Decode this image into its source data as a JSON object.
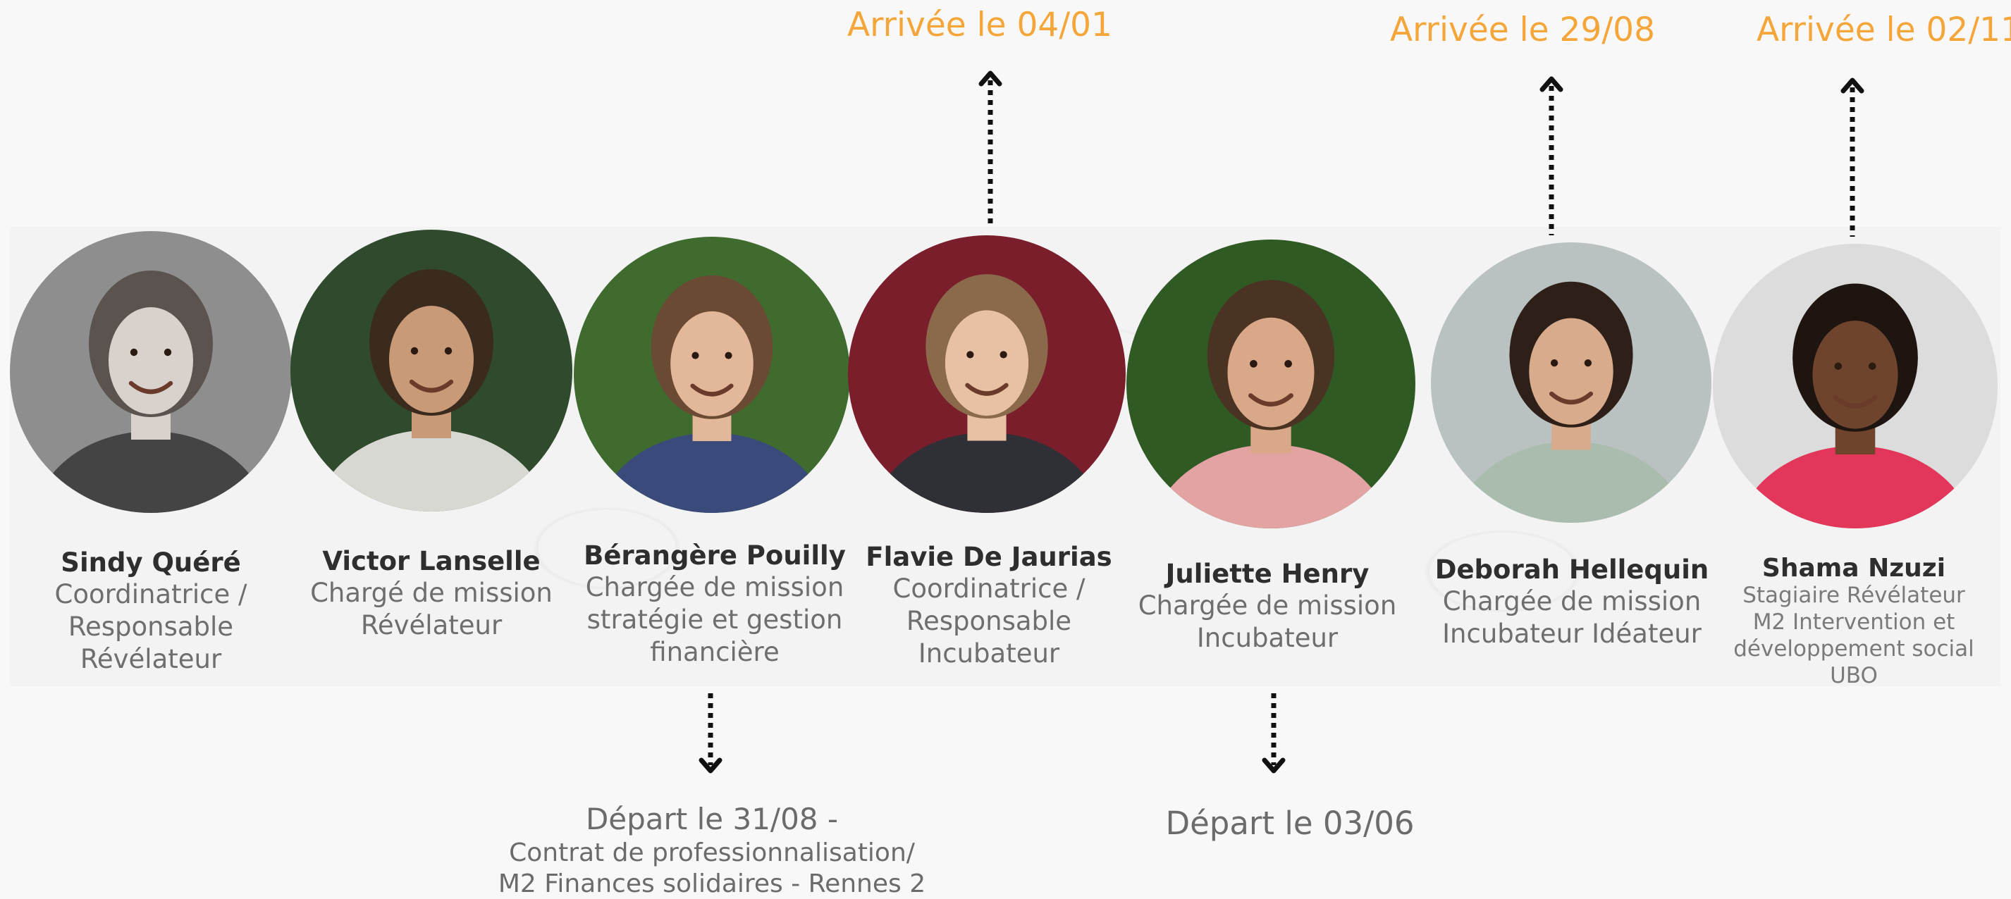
{
  "team": [
    {
      "name": "Sindy Quéré",
      "role": [
        "Coordinatrice /",
        "Responsable",
        "Révélateur"
      ],
      "photo_bg": "#8e8e8e",
      "tone": "#d9d2cc",
      "hair": "#5a5350",
      "shirt": "#444444"
    },
    {
      "name": "Victor Lanselle",
      "role": [
        "Chargé de mission",
        "Révélateur"
      ],
      "photo_bg": "#2f4a2c",
      "tone": "#c99a78",
      "hair": "#3b2a1e",
      "shirt": "#d8d8d2"
    },
    {
      "name": "Bérangère Pouilly",
      "role": [
        "Chargée de mission",
        "stratégie et gestion",
        "financière"
      ],
      "photo_bg": "#3f6b2e",
      "tone": "#e2b79a",
      "hair": "#6a4a33",
      "shirt": "#3a4a7a"
    },
    {
      "name": "Flavie De Jaurias",
      "role": [
        "Coordinatrice /",
        "Responsable",
        "Incubateur"
      ],
      "photo_bg": "#7a1e2c",
      "tone": "#e8c1a4",
      "hair": "#8a6a4a",
      "shirt": "#2f3036"
    },
    {
      "name": "Juliette Henry",
      "role": [
        "Chargée de mission",
        "Incubateur"
      ],
      "photo_bg": "#2f5a24",
      "tone": "#d9a888",
      "hair": "#4a3322",
      "shirt": "#e3a3a3"
    },
    {
      "name": "Deborah Hellequin",
      "role": [
        "Chargée de mission",
        "Incubateur Idéateur"
      ],
      "photo_bg": "#b9c2c0",
      "tone": "#d8ab8c",
      "hair": "#2e1f18",
      "shirt": "#a9bcae"
    },
    {
      "name": "Shama Nzuzi",
      "role": [
        "Stagiaire Révélateur",
        "M2 Intervention et",
        "développement social",
        "UBO"
      ],
      "photo_bg": "#dcdcdc",
      "tone": "#6e452c",
      "hair": "#1e1410",
      "shirt": "#e2375a"
    }
  ],
  "arrivals": [
    {
      "label": "Arrivée le 04/01"
    },
    {
      "label": "Arrivée le 29/08"
    },
    {
      "label": "Arrivée le 02/11"
    }
  ],
  "departures": [
    {
      "label": "Départ le 31/08 -",
      "detail": [
        "Contrat de professionnalisation/",
        "M2 Finances solidaires - Rennes 2"
      ]
    },
    {
      "label": "Départ le 03/06"
    }
  ],
  "colors": {
    "accent": "#f5a63a",
    "name_text": "#2e2e2e",
    "role_text": "#6e6e6e",
    "background": "#f8f8f8"
  }
}
